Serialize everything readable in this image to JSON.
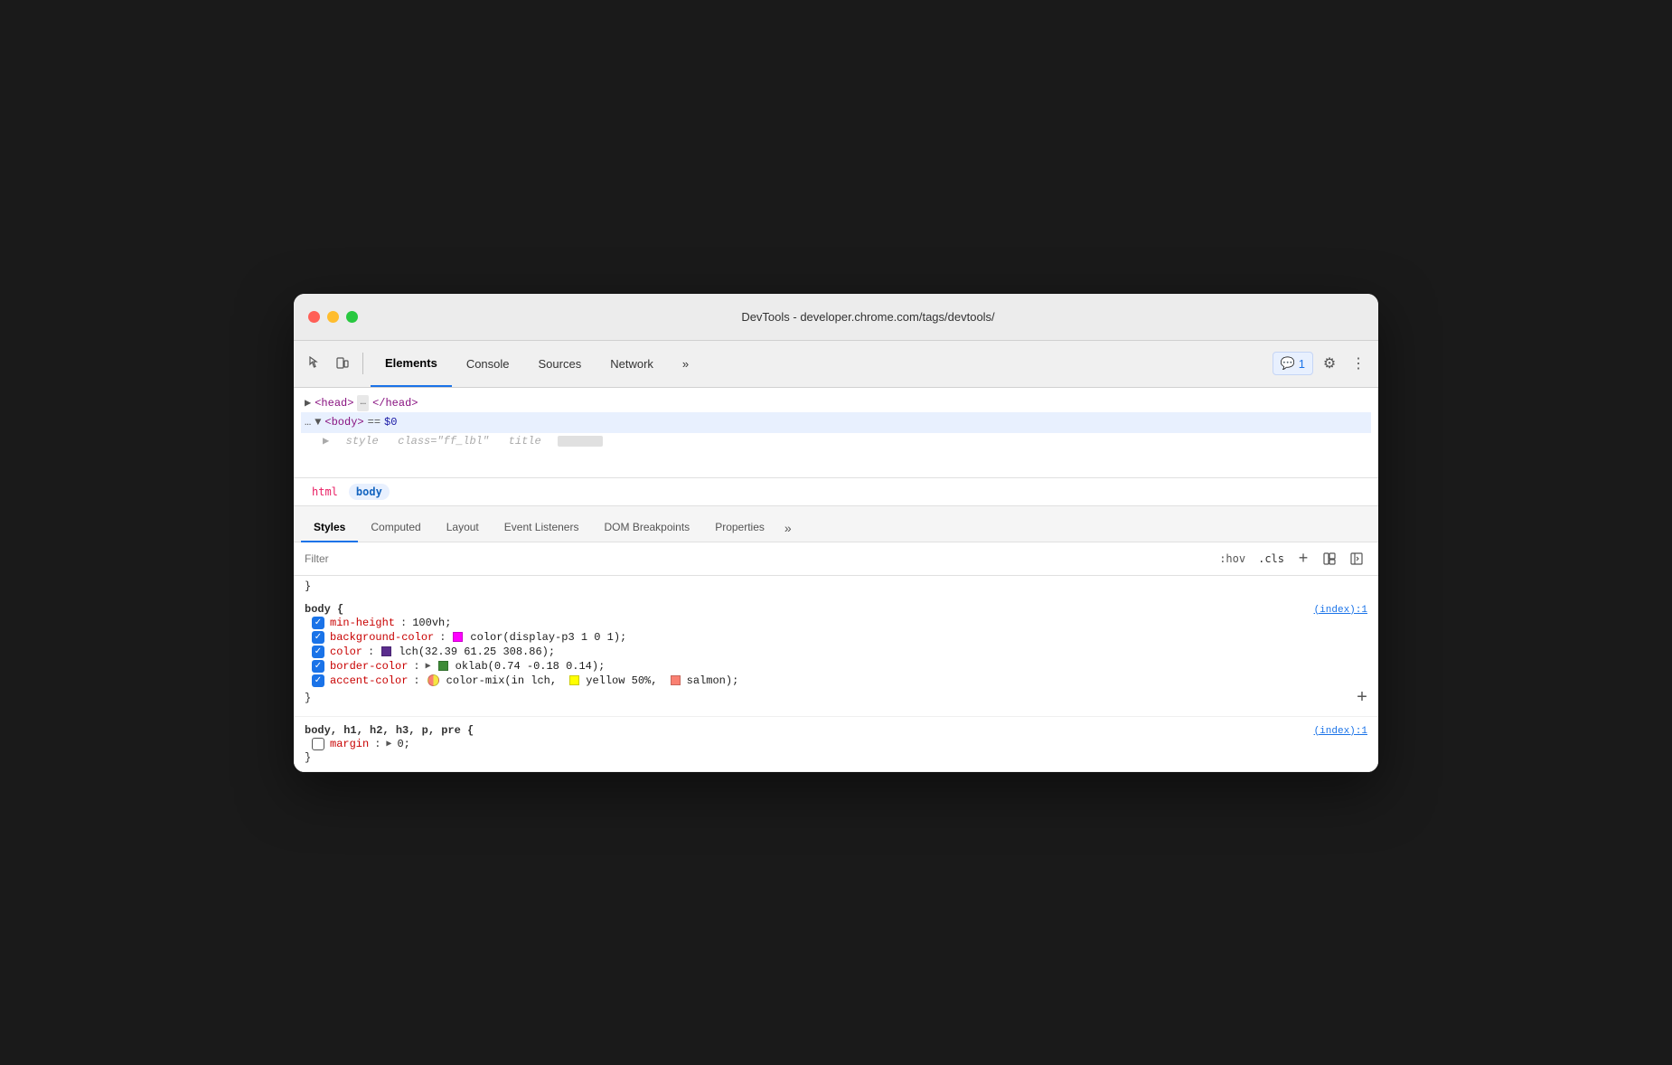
{
  "window": {
    "title": "DevTools - developer.chrome.com/tags/devtools/"
  },
  "traffic_lights": {
    "close": "close",
    "minimize": "minimize",
    "maximize": "maximize"
  },
  "toolbar": {
    "inspect_label": "Inspect",
    "device_label": "Device",
    "tabs": [
      {
        "id": "elements",
        "label": "Elements",
        "active": true
      },
      {
        "id": "console",
        "label": "Console",
        "active": false
      },
      {
        "id": "sources",
        "label": "Sources",
        "active": false
      },
      {
        "id": "network",
        "label": "Network",
        "active": false
      },
      {
        "id": "more",
        "label": "»",
        "active": false
      }
    ],
    "badge_count": "1",
    "more_icon": "⋮"
  },
  "elements_panel": {
    "head_line": "▶ <head> … </head>",
    "body_line": "… ▼ <body>  == $0",
    "blurred_line": "   ▶  style  class=\"ff_lbl\"  title"
  },
  "breadcrumb": {
    "items": [
      {
        "id": "html",
        "label": "html"
      },
      {
        "id": "body",
        "label": "body"
      }
    ]
  },
  "styles_panel": {
    "tabs": [
      {
        "id": "styles",
        "label": "Styles",
        "active": true
      },
      {
        "id": "computed",
        "label": "Computed",
        "active": false
      },
      {
        "id": "layout",
        "label": "Layout",
        "active": false
      },
      {
        "id": "event-listeners",
        "label": "Event Listeners",
        "active": false
      },
      {
        "id": "dom-breakpoints",
        "label": "DOM Breakpoints",
        "active": false
      },
      {
        "id": "properties",
        "label": "Properties",
        "active": false
      },
      {
        "id": "more",
        "label": "»",
        "active": false
      }
    ]
  },
  "filter": {
    "placeholder": "Filter",
    "hov_label": ":hov",
    "cls_label": ".cls",
    "plus_label": "+",
    "style_icon": "🖌",
    "sidebar_icon": "◀"
  },
  "css_rules": [
    {
      "id": "rule1",
      "selector": "body {",
      "source": "(index):1",
      "closing": "}",
      "properties": [
        {
          "id": "min-height",
          "enabled": true,
          "name": "min-height",
          "value": "100vh;",
          "color_swatch": null
        },
        {
          "id": "background-color",
          "enabled": true,
          "name": "background-color",
          "value": "color(display-p3 1 0 1);",
          "color_swatch": "magenta"
        },
        {
          "id": "color",
          "enabled": true,
          "name": "color",
          "value": "lch(32.39 61.25 308.86);",
          "color_swatch": "purple"
        },
        {
          "id": "border-color",
          "enabled": true,
          "name": "border-color",
          "value": "oklab(0.74 -0.18 0.14);",
          "color_swatch": "green",
          "has_expand": true
        },
        {
          "id": "accent-color",
          "enabled": true,
          "name": "accent-color",
          "value": "color-mix(in lch,",
          "color_swatch": "mixed",
          "extra": "yellow 50%,",
          "extra_swatch": "yellow",
          "final": "salmon);"
        }
      ]
    },
    {
      "id": "rule2",
      "selector": "body, h1, h2, h3, p, pre {",
      "source": "(index):1",
      "closing": "}",
      "properties": [
        {
          "id": "margin",
          "enabled": false,
          "name": "margin",
          "value": "0;",
          "has_expand": true
        }
      ]
    }
  ]
}
